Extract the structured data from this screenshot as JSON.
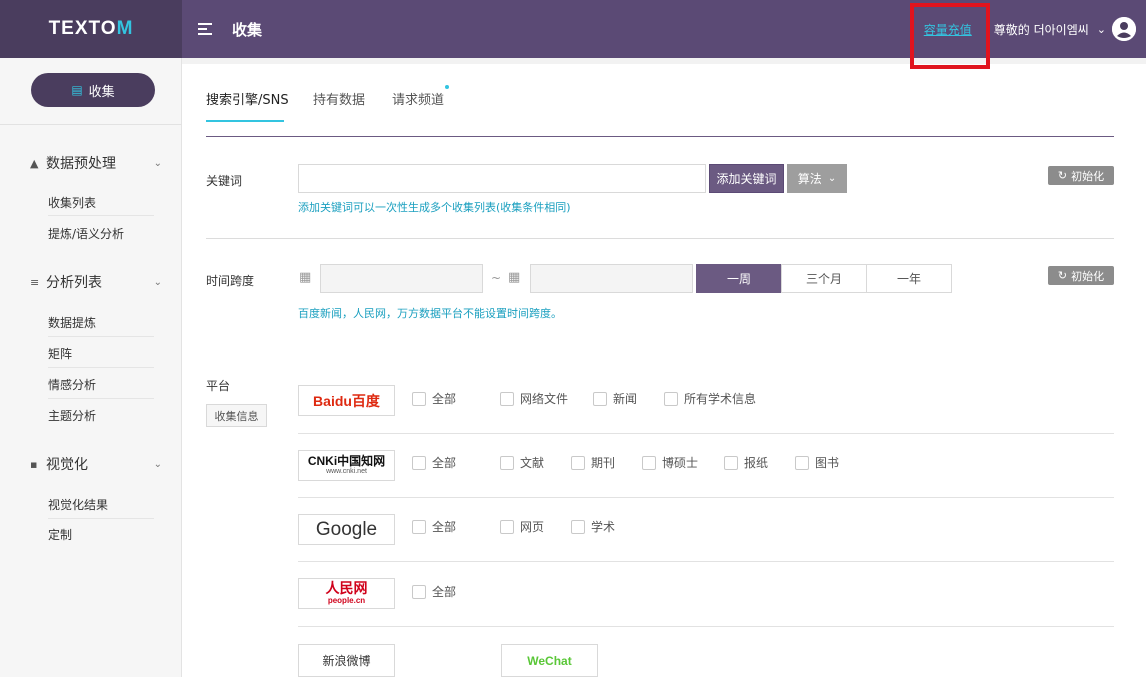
{
  "app": {
    "logo_prefix": "TEXTO",
    "logo_accent": "M",
    "page_title": "收集"
  },
  "header": {
    "recharge_label": "容量充值",
    "username": "尊敬的 더아이엠씨"
  },
  "sidebar": {
    "collect_button": "收集",
    "groups": [
      {
        "label": "数据预处理",
        "items": [
          "收集列表",
          "提炼/语义分析"
        ]
      },
      {
        "label": "分析列表",
        "items": [
          "数据提炼",
          "矩阵",
          "情感分析",
          "主题分析"
        ]
      },
      {
        "label": "视觉化",
        "items": [
          "视觉化结果",
          "定制"
        ]
      }
    ]
  },
  "tabs": [
    "搜索引擎/SNS",
    "持有数据",
    "请求频道"
  ],
  "keyword": {
    "label": "关键词",
    "value": "",
    "add_button": "添加关键词",
    "algo_button": "算法",
    "hint": "添加关键词可以一次性生成多个收集列表(收集条件相同)",
    "reset": "初始化"
  },
  "timespan": {
    "label": "时间跨度",
    "start": "",
    "end": "",
    "separator": "~",
    "periods": [
      "一周",
      "三个月",
      "一年"
    ],
    "active_period": "一周",
    "hint": "百度新闻，人民网，万方数据平台不能设置时间跨度。",
    "reset": "初始化"
  },
  "platform": {
    "label": "平台",
    "info_button": "收集信息",
    "rows": [
      {
        "logo": "Baidu百度",
        "options": [
          "全部",
          "网络文件",
          "新闻",
          "所有学术信息"
        ]
      },
      {
        "logo": "CNKi中国知网",
        "logo_sub": "www.cnki.net",
        "options": [
          "全部",
          "文献",
          "期刊",
          "博硕士",
          "报纸",
          "图书"
        ]
      },
      {
        "logo": "Google",
        "options": [
          "全部",
          "网页",
          "学术"
        ]
      },
      {
        "logo": "人民网",
        "logo_sub": "people.cn",
        "options": [
          "全部"
        ]
      }
    ],
    "extra_logos": [
      "新浪微博",
      "WeChat"
    ]
  },
  "colors": {
    "header_bg": "#5b4a75",
    "logo_bg": "#4a3d5e",
    "accent": "#33c4e0",
    "primary_button": "#6b5a82",
    "highlight": "#e0141e"
  }
}
